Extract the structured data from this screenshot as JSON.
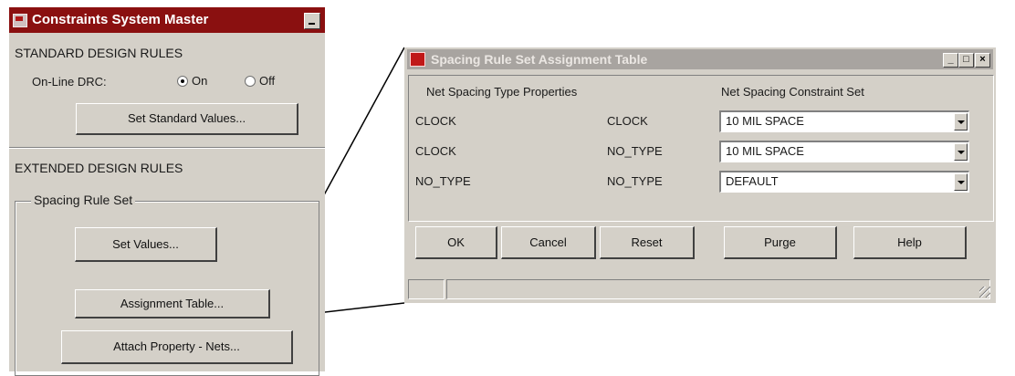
{
  "master": {
    "title": "Constraints System Master",
    "standard_heading": "STANDARD DESIGN RULES",
    "online_drc_label": "On-Line DRC:",
    "radio_on_label": "On",
    "radio_off_label": "Off",
    "drc_selected": "On",
    "set_standard_button": "Set Standard Values...",
    "extended_heading": "EXTENDED DESIGN RULES",
    "spacing_group_label": "Spacing Rule Set",
    "set_values_button": "Set Values...",
    "assignment_table_button": "Assignment Table...",
    "attach_property_button": "Attach Property - Nets..."
  },
  "dialog": {
    "title": "Spacing Rule Set   Assignment Table",
    "header_properties": "Net Spacing Type Properties",
    "header_constraint": "Net Spacing Constraint Set",
    "rows": [
      {
        "type_a": "CLOCK",
        "type_b": "CLOCK",
        "constraint": "10 MIL SPACE"
      },
      {
        "type_a": "CLOCK",
        "type_b": "NO_TYPE",
        "constraint": "10 MIL SPACE"
      },
      {
        "type_a": "NO_TYPE",
        "type_b": "NO_TYPE",
        "constraint": "DEFAULT"
      }
    ],
    "buttons": {
      "ok": "OK",
      "cancel": "Cancel",
      "reset": "Reset",
      "purge": "Purge",
      "help": "Help"
    },
    "window_controls": {
      "minimize": "_",
      "maximize": "□",
      "close": "×"
    }
  },
  "colors": {
    "titlebar_active": "#8a1010",
    "titlebar_inactive": "#a8a4a0",
    "face": "#d4d0c8"
  }
}
